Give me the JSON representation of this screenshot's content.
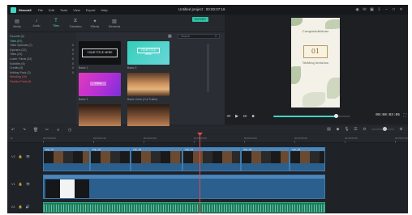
{
  "titlebar": {
    "app_name": "filmora9",
    "menu": [
      "File",
      "Edit",
      "Tools",
      "View",
      "Export",
      "Help"
    ],
    "doc_title": "Untitled project : 00:00:07:16"
  },
  "media": {
    "tabs": [
      {
        "label": "Media",
        "icon": "folder-icon"
      },
      {
        "label": "Audio",
        "icon": "music-icon"
      },
      {
        "label": "Titles",
        "icon": "text-icon"
      },
      {
        "label": "Transition",
        "icon": "transition-icon"
      },
      {
        "label": "Effects",
        "icon": "effects-icon"
      },
      {
        "label": "Elements",
        "icon": "elements-icon"
      }
    ],
    "export_label": "EXPORT",
    "search_placeholder": "Search",
    "tree": [
      {
        "label": "Favorite (0)",
        "count": ""
      },
      {
        "label": "Titles (87)",
        "count": ""
      },
      {
        "label": "Titles Specials (7)",
        "count": "0"
      },
      {
        "label": "Openers (22)",
        "count": "0"
      },
      {
        "label": "Titles (24)",
        "count": "0"
      },
      {
        "label": "Lower Thirds (20)",
        "count": "0"
      },
      {
        "label": "Subtitles (5)",
        "count": "0"
      },
      {
        "label": "Credits (5)",
        "count": "0"
      },
      {
        "label": "Holiday Pack (2)",
        "count": "0"
      },
      {
        "label": "Wedding (15)",
        "count": ""
      },
      {
        "label": "Fashion Pack (9)",
        "count": ""
      }
    ],
    "cards": [
      {
        "label": "Basic 1",
        "thumb_text": "YOUR TITLE HERE"
      },
      {
        "label": "Basic 2",
        "thumb_text": "YOUR TITLE HERE"
      },
      {
        "label": "Basic 3",
        "thumb_text": "TITLE"
      },
      {
        "label": "Basic Lines (Cut Trailer)",
        "thumb_text": ""
      },
      {
        "label": "Basic 5",
        "thumb_text": ""
      },
      {
        "label": "Basic 6",
        "thumb_text": ""
      }
    ]
  },
  "preview": {
    "card_top": "Congratulations",
    "card_badge": "01",
    "card_bottom": "Wedding Invitation",
    "timecode": "00:00:03:05",
    "progress": 0.82
  },
  "timeline": {
    "ruler": [
      "00:00:00:00",
      "00:00:01:00",
      "00:00:02:00",
      "00:00:03:00",
      "00:00:04:00",
      "00:00:05:00",
      "00:00:06:00",
      "00:00:07:00"
    ],
    "tracks": [
      "V2",
      "V1",
      "A1"
    ],
    "clip_labels": [
      "Clip_01",
      "Clip_02",
      "Clip_03",
      "Clip_04",
      "Clip_05",
      "Clip_06"
    ],
    "zoom": 0.6
  },
  "colors": {
    "accent": "#3fd6c3",
    "playhead": "#e44a4a",
    "video_clip": "#2b5f8e",
    "audio_clip": "#1f7a5c"
  }
}
